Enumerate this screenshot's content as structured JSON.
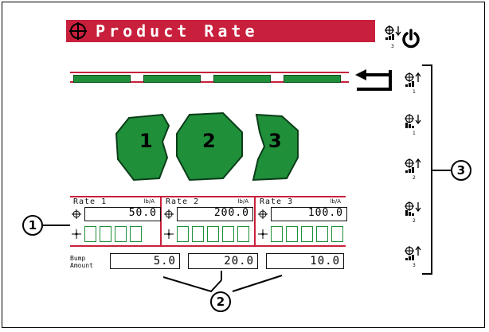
{
  "title": "Product Rate",
  "header_icon_label": "3",
  "lanes": {
    "count": 4,
    "color": "#1f8f3a"
  },
  "products": [
    {
      "label": "1",
      "color": "#1f8f3a"
    },
    {
      "label": "2",
      "color": "#1f8f3a"
    },
    {
      "label": "3",
      "color": "#1f8f3a"
    }
  ],
  "rates": [
    {
      "header": "Rate 1",
      "unit": "lb/A",
      "value": "50.0"
    },
    {
      "header": "Rate 2",
      "unit": "lb/A",
      "value": "200.0"
    },
    {
      "header": "Rate 3",
      "unit": "lb/A",
      "value": "100.0"
    }
  ],
  "bump": {
    "label_line1": "Bump",
    "label_line2": "Amount",
    "values": [
      "5.0",
      "20.0",
      "10.0"
    ]
  },
  "side_buttons": [
    {
      "label": "1",
      "direction": "up"
    },
    {
      "label": "1",
      "direction": "down"
    },
    {
      "label": "2",
      "direction": "up"
    },
    {
      "label": "2",
      "direction": "down"
    },
    {
      "label": "3",
      "direction": "up"
    }
  ],
  "callouts": {
    "left": "1",
    "bottom": "2",
    "right": "3"
  },
  "colors": {
    "accent": "#c8203c",
    "section_green": "#1f8f3a"
  }
}
